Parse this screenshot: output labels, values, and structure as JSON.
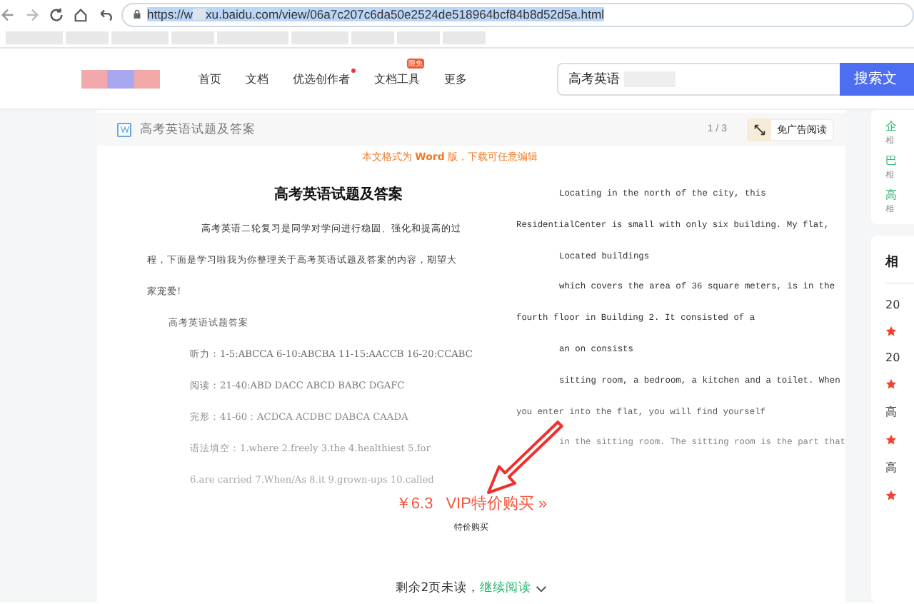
{
  "browser": {
    "url_start": "https://w",
    "url_end": "xu.baidu.com/view/06a7c207c6da50e2524de518964bcf84b8d52d5a.html",
    "url_selected": true
  },
  "header": {
    "nav": [
      {
        "label": "首页",
        "dot": false
      },
      {
        "label": "文档",
        "dot": false
      },
      {
        "label": "优选创作者",
        "dot": true
      },
      {
        "label": "文档工具",
        "dot": false,
        "badge": "限免"
      },
      {
        "label": "更多",
        "dot": false
      }
    ],
    "search": {
      "value": "高考英语",
      "button": "搜索文"
    }
  },
  "doc_bar": {
    "title": "高考英语试题及答案",
    "page": "1 / 3",
    "ad_free_button": "免广告阅读"
  },
  "notice": "本文格式为 **Word** 版，下载可任意编辑",
  "page": {
    "title": "高考英语试题及答案",
    "left_lines": [
      {
        "text": "高考英语二轮复习是同学对学问进行稳固、强化和提高的过",
        "kind": "opening"
      },
      {
        "text": "程，下面是学习啦我为你整理关于高考英语试题及答案的内容，期望大",
        "kind": "continued"
      },
      {
        "text": "家宠爱!",
        "kind": "continued"
      },
      {
        "text": "高考英语试题答案",
        "kind": "subheading"
      },
      {
        "text": "听力：1-5:ABCCA 6-10:ABCBA 11-15:AACCB 16-20:CCABC",
        "kind": "answer"
      },
      {
        "text": "阅读：21-40:ABD DACC ABCD BABC DGAFC",
        "kind": "answer"
      },
      {
        "text": "完形：41-60：ACDCA ACDBC DABCA CAADA",
        "kind": "answer"
      },
      {
        "text": "语法填空：1.where 2.freely 3.the 4.healthiest 5.for",
        "kind": "answer"
      },
      {
        "text": "6.are carried 7.When/As 8.it 9.grown-ups 10.called",
        "kind": "answer"
      }
    ],
    "right_lines": [
      {
        "text": "Locating in the north of the city, this",
        "kind": "opening"
      },
      {
        "text": "ResidentialCenter is small with only six building. My flat,",
        "kind": "continued"
      },
      {
        "text": "Located buildings",
        "kind": "opening"
      },
      {
        "text": "which covers the area of 36 square meters, is in the",
        "kind": "opening"
      },
      {
        "text": "fourth floor in Building 2. It consisted of a",
        "kind": "continued"
      },
      {
        "text": "an on consists",
        "kind": "opening"
      },
      {
        "text": "sitting room, a bedroom, a kitchen and a toilet. When",
        "kind": "opening"
      },
      {
        "text": "you enter into the flat, you will find yourself",
        "kind": "continued"
      },
      {
        "text": "in the sitting room. The sitting room is the part that",
        "kind": "opening"
      }
    ]
  },
  "purchase": {
    "price": "￥6.3",
    "label": "VIP特价购买 »",
    "sub": "特价购买"
  },
  "continue": {
    "remaining": "剩余2页未读，",
    "link": "继续阅读"
  },
  "sidebar": {
    "top_items": [
      {
        "title": "企",
        "meta": "相"
      },
      {
        "title": "巴",
        "meta": "相"
      },
      {
        "title": "高",
        "meta": "相"
      }
    ],
    "related_heading": "相",
    "related": [
      "20",
      "20",
      "高",
      "高"
    ]
  }
}
